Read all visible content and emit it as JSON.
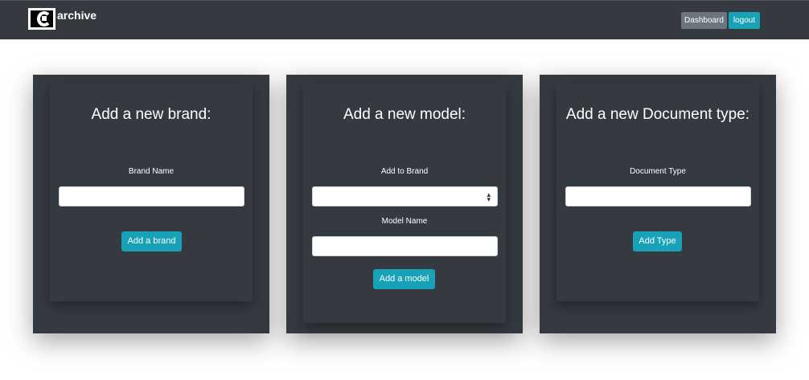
{
  "navbar": {
    "brand_text": "archive",
    "logo_icon": "c-logo-icon",
    "dashboard_label": "Dashboard",
    "logout_label": "logout"
  },
  "brand_form": {
    "title": "Add a new brand:",
    "field_label": "Brand Name",
    "field_value": "",
    "button_label": "Add a brand"
  },
  "model_form": {
    "title": "Add a new model:",
    "brand_label": "Add to Brand",
    "brand_selected": "",
    "model_label": "Model Name",
    "model_value": "",
    "button_label": "Add a model"
  },
  "doctype_form": {
    "title": "Add a new Document type:",
    "field_label": "Document Type",
    "field_value": "",
    "button_label": "Add Type"
  },
  "colors": {
    "navbar_bg": "#343a40",
    "panel_bg": "#343a40",
    "accent": "#17a2b8",
    "secondary": "#6c757d"
  }
}
